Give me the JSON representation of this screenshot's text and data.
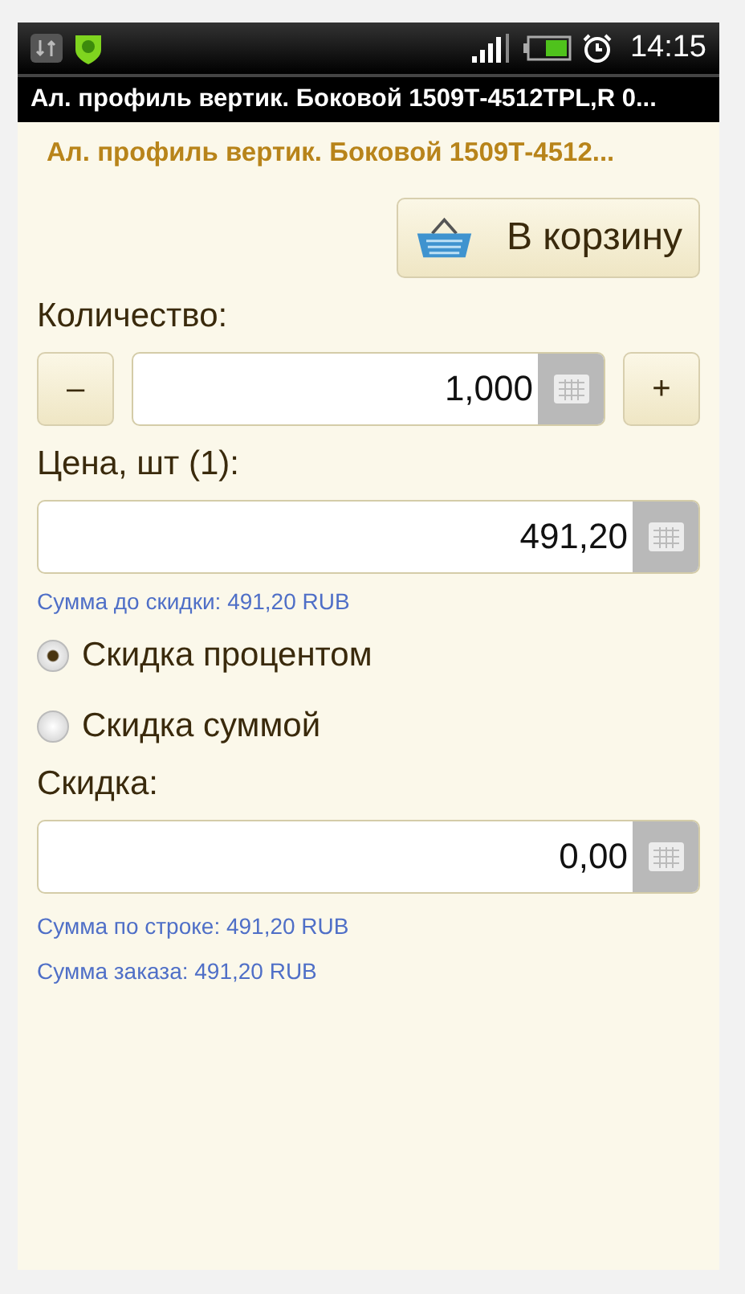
{
  "status_bar": {
    "time": "14:15"
  },
  "window": {
    "title": "Ал. профиль вертик. Боковой 1509Т-4512TPL,R 0..."
  },
  "heading": "Ал. профиль вертик. Боковой 1509Т-4512...",
  "cart_button": {
    "label": "В корзину"
  },
  "quantity": {
    "label": "Количество:",
    "value": "1,000",
    "minus": "–",
    "plus": "+"
  },
  "price": {
    "label": "Цена, шт (1):",
    "value": "491,20",
    "note": "Сумма до скидки: 491,20 RUB"
  },
  "discount_types": [
    {
      "label": "Скидка процентом",
      "selected": true
    },
    {
      "label": "Скидка суммой",
      "selected": false
    }
  ],
  "discount": {
    "label": "Скидка:",
    "value": "0,00"
  },
  "totals": [
    "Сумма по строке: 491,20 RUB",
    "Сумма заказа: 491,20 RUB"
  ]
}
